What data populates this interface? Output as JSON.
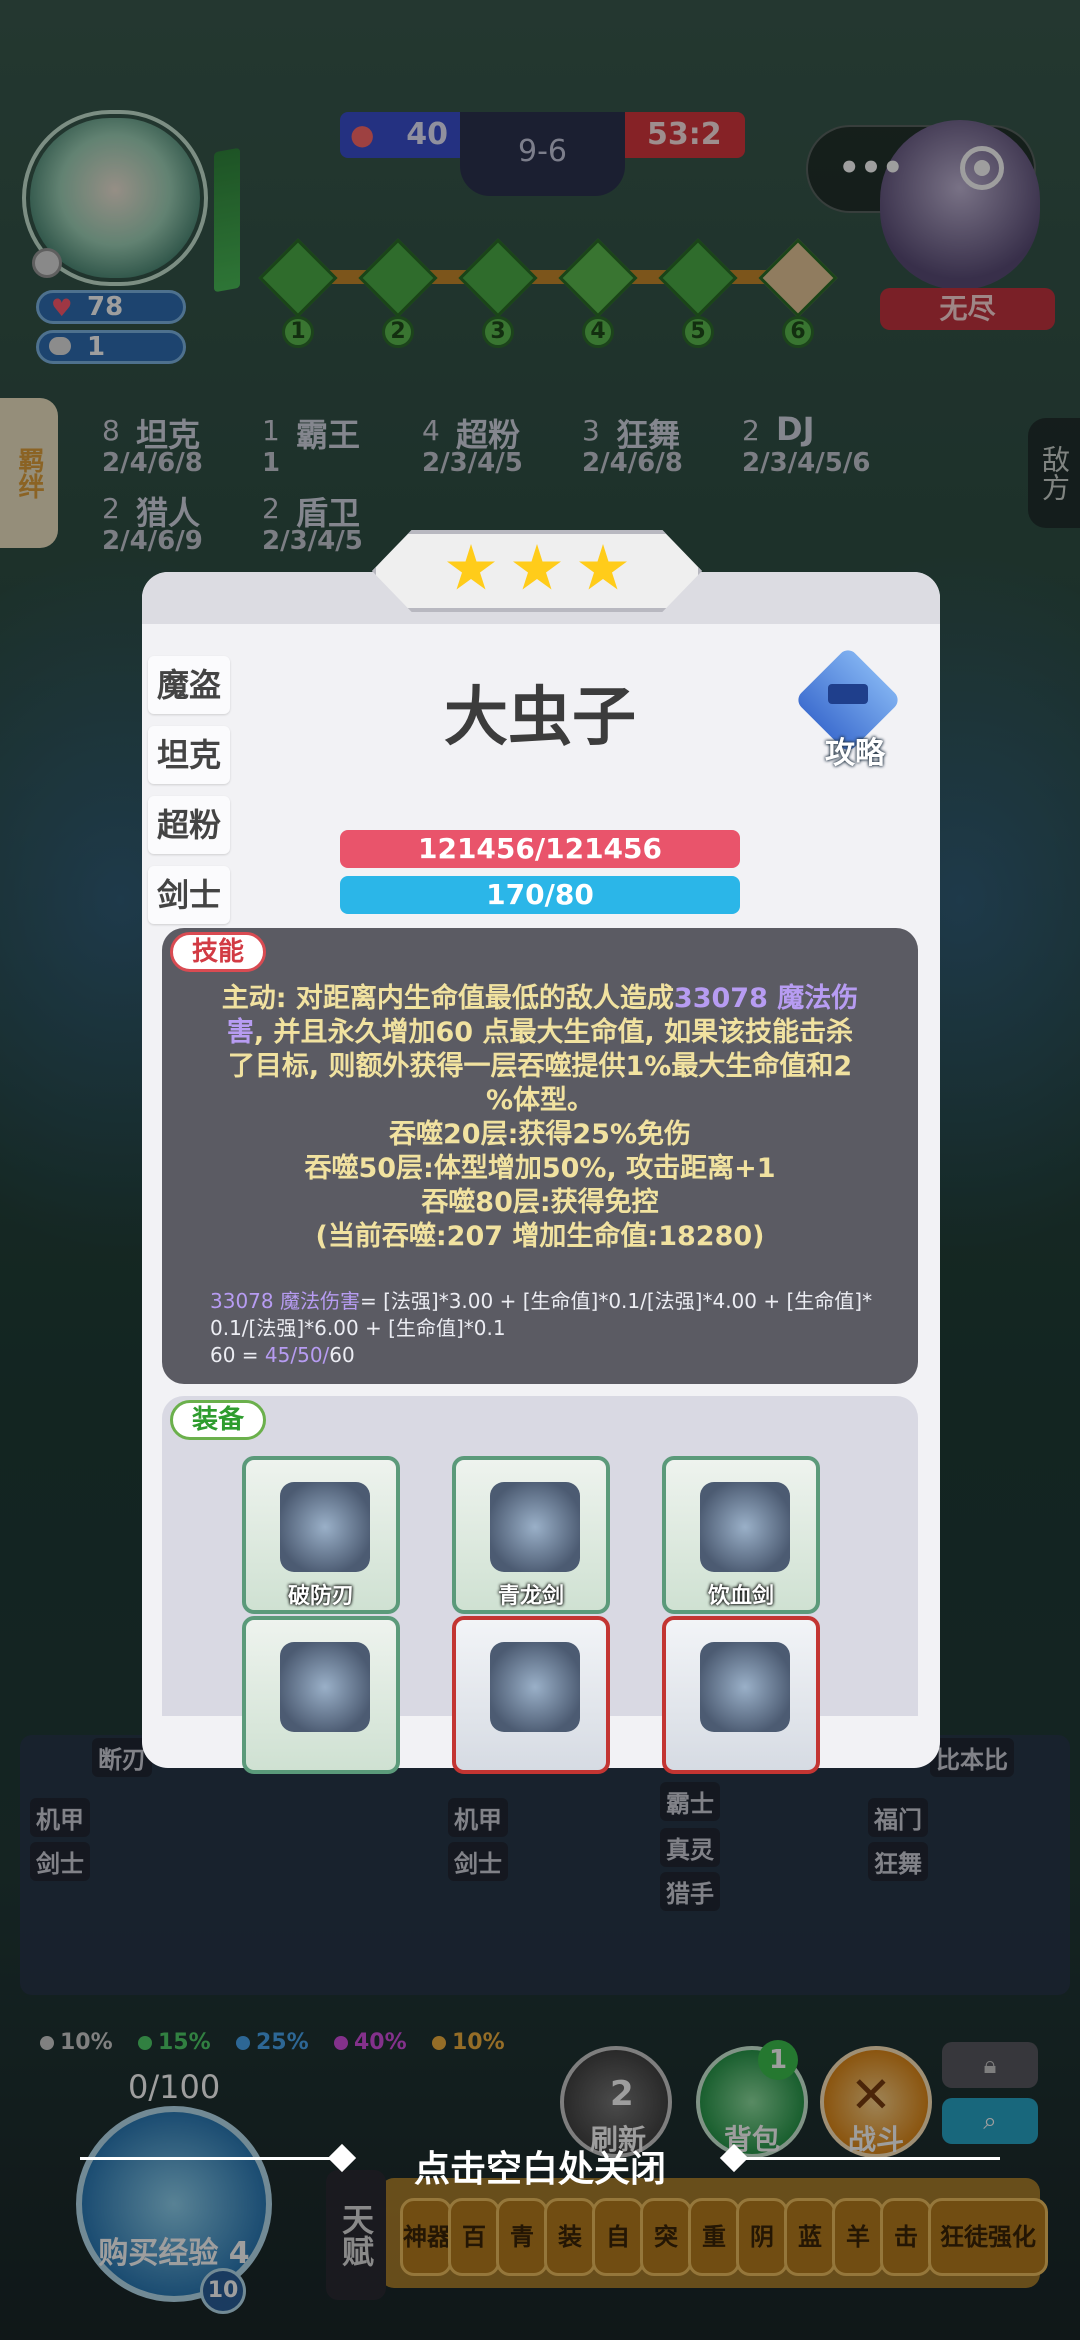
{
  "hud": {
    "player_hp": "78",
    "player_coins": "1",
    "score_left": "40",
    "stage": "9-6",
    "score_right": "53:2",
    "opponent_name": "无尽",
    "stage_nodes": [
      "1",
      "2",
      "3",
      "4",
      "5",
      "6"
    ]
  },
  "side_tabs": {
    "left": "羁绊",
    "right": "敌方"
  },
  "synergies": [
    {
      "count": "8",
      "name": "坦克",
      "steps": "2/4/6/8"
    },
    {
      "count": "1",
      "name": "霸王",
      "steps": "1"
    },
    {
      "count": "4",
      "name": "超粉",
      "steps": "2/3/4/5"
    },
    {
      "count": "3",
      "name": "狂舞",
      "steps": "2/4/6/8"
    },
    {
      "count": "2",
      "name": "DJ",
      "steps": "2/3/4/5/6"
    },
    {
      "count": "2",
      "name": "猎人",
      "steps": "2/4/6/9"
    },
    {
      "count": "2",
      "name": "盾卫",
      "steps": "2/3/4/5"
    }
  ],
  "unit": {
    "stars": 3,
    "name": "大虫子",
    "tags": [
      "魔盗",
      "坦克",
      "超粉",
      "剑士"
    ],
    "guide_label": "攻略",
    "hp_text": "121456/121456",
    "mp_text": "170/80",
    "hp_fraction": 1.0,
    "mp_fraction": 1.0
  },
  "skill": {
    "label": "技能",
    "line1_a": "主动: 对距离内生命值最低的敌人造成",
    "line1_hl": "33078 魔法伤",
    "line2_hl": "害",
    "line2_b": ", 并且永久增加60 点最大生命值, 如果该技能击杀",
    "line3": "了目标, 则额外获得一层吞噬提供1%最大生命值和2",
    "line4": "%体型。",
    "line5": "吞噬20层:获得25%免伤",
    "line6": "吞噬50层:体型增加50%, 攻击距离+1",
    "line7": "吞噬80层:获得免控",
    "line8": "(当前吞噬:207 增加生命值:18280)",
    "formula1_hl": "33078 魔法伤害",
    "formula1_b": "= [法强]*3.00 + [生命值]*0.1/[法强]*4.00 + [生命值]*",
    "formula2": "0.1/[法强]*6.00 + [生命值]*0.1",
    "formula3_a": "60 = ",
    "formula3_hl": "45/50/",
    "formula3_b": "60"
  },
  "equipment": {
    "label": "装备",
    "items": [
      {
        "name": "破防刃",
        "icon": "claw-blade-icon",
        "border": "green"
      },
      {
        "name": "青龙剑",
        "icon": "green-sword-icon",
        "border": "green"
      },
      {
        "name": "饮血剑",
        "icon": "blood-scythe-icon",
        "border": "green"
      },
      {
        "name": "",
        "icon": "blue-cube-icon",
        "border": "green"
      },
      {
        "name": "",
        "icon": "green-helmet-icon",
        "border": "red"
      },
      {
        "name": "",
        "icon": "ice-armor-icon",
        "border": "red"
      }
    ]
  },
  "bench": {
    "odds": [
      "10%",
      "15%",
      "25%",
      "40%",
      "10%"
    ],
    "odds_colors": [
      "#cfcfcf",
      "#4fcf6a",
      "#4aa6f0",
      "#d44fe0",
      "#f0b040"
    ],
    "exp": "0/100",
    "buy_exp_label": "购买经验 4",
    "level": "10",
    "refresh_label": "刷新",
    "refresh_cost": "2",
    "bag_label": "背包",
    "bag_badge": "1",
    "battle_label": "战斗",
    "talent_label": "天赋",
    "shop_items": [
      "神器",
      "百",
      "青",
      "装",
      "自",
      "突",
      "重",
      "阴",
      "蓝",
      "羊",
      "击",
      "狂徒强化"
    ],
    "card_tags": [
      "断刃",
      "机甲",
      "剑士",
      "机甲",
      "剑士",
      "霸士",
      "真灵",
      "猎手",
      "福门",
      "狂舞",
      "比本比"
    ]
  },
  "close_hint": "点击空白处关闭"
}
